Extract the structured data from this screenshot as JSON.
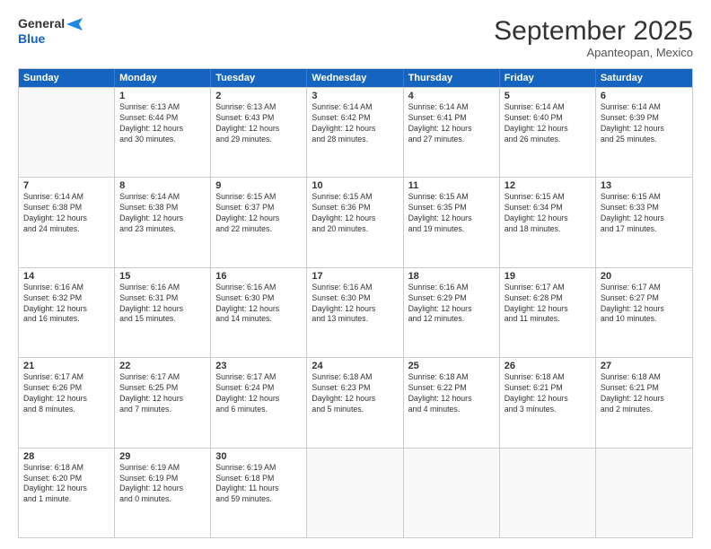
{
  "header": {
    "logo_line1": "General",
    "logo_line2": "Blue",
    "month": "September 2025",
    "location": "Apanteopan, Mexico"
  },
  "weekdays": [
    "Sunday",
    "Monday",
    "Tuesday",
    "Wednesday",
    "Thursday",
    "Friday",
    "Saturday"
  ],
  "rows": [
    [
      {
        "day": "",
        "info": ""
      },
      {
        "day": "1",
        "info": "Sunrise: 6:13 AM\nSunset: 6:44 PM\nDaylight: 12 hours\nand 30 minutes."
      },
      {
        "day": "2",
        "info": "Sunrise: 6:13 AM\nSunset: 6:43 PM\nDaylight: 12 hours\nand 29 minutes."
      },
      {
        "day": "3",
        "info": "Sunrise: 6:14 AM\nSunset: 6:42 PM\nDaylight: 12 hours\nand 28 minutes."
      },
      {
        "day": "4",
        "info": "Sunrise: 6:14 AM\nSunset: 6:41 PM\nDaylight: 12 hours\nand 27 minutes."
      },
      {
        "day": "5",
        "info": "Sunrise: 6:14 AM\nSunset: 6:40 PM\nDaylight: 12 hours\nand 26 minutes."
      },
      {
        "day": "6",
        "info": "Sunrise: 6:14 AM\nSunset: 6:39 PM\nDaylight: 12 hours\nand 25 minutes."
      }
    ],
    [
      {
        "day": "7",
        "info": "Sunrise: 6:14 AM\nSunset: 6:38 PM\nDaylight: 12 hours\nand 24 minutes."
      },
      {
        "day": "8",
        "info": "Sunrise: 6:14 AM\nSunset: 6:38 PM\nDaylight: 12 hours\nand 23 minutes."
      },
      {
        "day": "9",
        "info": "Sunrise: 6:15 AM\nSunset: 6:37 PM\nDaylight: 12 hours\nand 22 minutes."
      },
      {
        "day": "10",
        "info": "Sunrise: 6:15 AM\nSunset: 6:36 PM\nDaylight: 12 hours\nand 20 minutes."
      },
      {
        "day": "11",
        "info": "Sunrise: 6:15 AM\nSunset: 6:35 PM\nDaylight: 12 hours\nand 19 minutes."
      },
      {
        "day": "12",
        "info": "Sunrise: 6:15 AM\nSunset: 6:34 PM\nDaylight: 12 hours\nand 18 minutes."
      },
      {
        "day": "13",
        "info": "Sunrise: 6:15 AM\nSunset: 6:33 PM\nDaylight: 12 hours\nand 17 minutes."
      }
    ],
    [
      {
        "day": "14",
        "info": "Sunrise: 6:16 AM\nSunset: 6:32 PM\nDaylight: 12 hours\nand 16 minutes."
      },
      {
        "day": "15",
        "info": "Sunrise: 6:16 AM\nSunset: 6:31 PM\nDaylight: 12 hours\nand 15 minutes."
      },
      {
        "day": "16",
        "info": "Sunrise: 6:16 AM\nSunset: 6:30 PM\nDaylight: 12 hours\nand 14 minutes."
      },
      {
        "day": "17",
        "info": "Sunrise: 6:16 AM\nSunset: 6:30 PM\nDaylight: 12 hours\nand 13 minutes."
      },
      {
        "day": "18",
        "info": "Sunrise: 6:16 AM\nSunset: 6:29 PM\nDaylight: 12 hours\nand 12 minutes."
      },
      {
        "day": "19",
        "info": "Sunrise: 6:17 AM\nSunset: 6:28 PM\nDaylight: 12 hours\nand 11 minutes."
      },
      {
        "day": "20",
        "info": "Sunrise: 6:17 AM\nSunset: 6:27 PM\nDaylight: 12 hours\nand 10 minutes."
      }
    ],
    [
      {
        "day": "21",
        "info": "Sunrise: 6:17 AM\nSunset: 6:26 PM\nDaylight: 12 hours\nand 8 minutes."
      },
      {
        "day": "22",
        "info": "Sunrise: 6:17 AM\nSunset: 6:25 PM\nDaylight: 12 hours\nand 7 minutes."
      },
      {
        "day": "23",
        "info": "Sunrise: 6:17 AM\nSunset: 6:24 PM\nDaylight: 12 hours\nand 6 minutes."
      },
      {
        "day": "24",
        "info": "Sunrise: 6:18 AM\nSunset: 6:23 PM\nDaylight: 12 hours\nand 5 minutes."
      },
      {
        "day": "25",
        "info": "Sunrise: 6:18 AM\nSunset: 6:22 PM\nDaylight: 12 hours\nand 4 minutes."
      },
      {
        "day": "26",
        "info": "Sunrise: 6:18 AM\nSunset: 6:21 PM\nDaylight: 12 hours\nand 3 minutes."
      },
      {
        "day": "27",
        "info": "Sunrise: 6:18 AM\nSunset: 6:21 PM\nDaylight: 12 hours\nand 2 minutes."
      }
    ],
    [
      {
        "day": "28",
        "info": "Sunrise: 6:18 AM\nSunset: 6:20 PM\nDaylight: 12 hours\nand 1 minute."
      },
      {
        "day": "29",
        "info": "Sunrise: 6:19 AM\nSunset: 6:19 PM\nDaylight: 12 hours\nand 0 minutes."
      },
      {
        "day": "30",
        "info": "Sunrise: 6:19 AM\nSunset: 6:18 PM\nDaylight: 11 hours\nand 59 minutes."
      },
      {
        "day": "",
        "info": ""
      },
      {
        "day": "",
        "info": ""
      },
      {
        "day": "",
        "info": ""
      },
      {
        "day": "",
        "info": ""
      }
    ]
  ]
}
